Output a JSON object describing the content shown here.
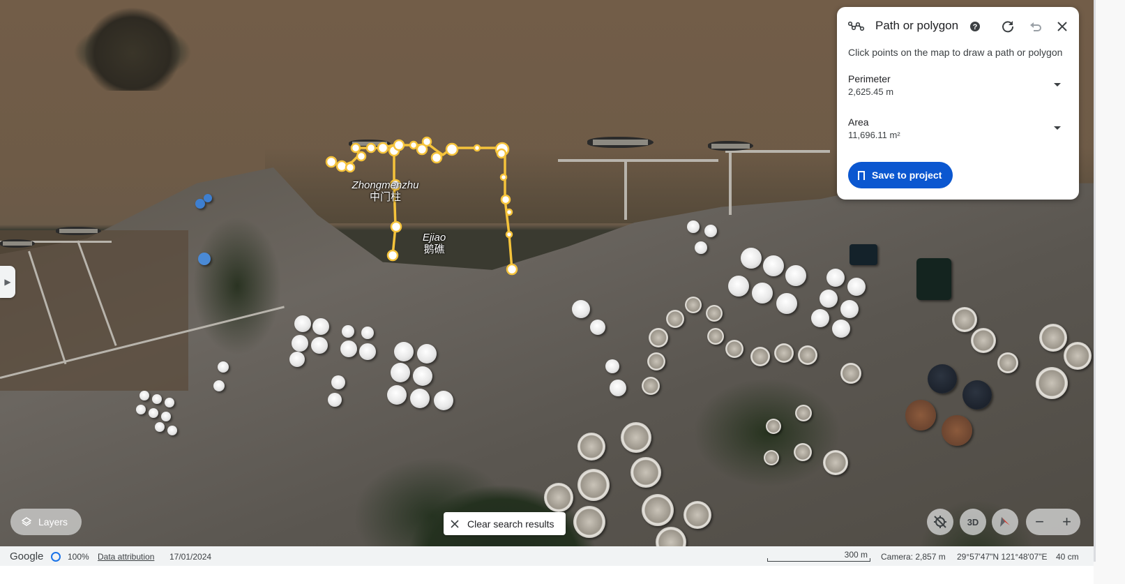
{
  "panel": {
    "title": "Path or polygon",
    "hint": "Click points on the map to draw a path or polygon",
    "perimeter": {
      "label": "Perimeter",
      "value": "2,625.45 m"
    },
    "area": {
      "label": "Area",
      "value": "11,696.11 m²"
    },
    "save_label": "Save to project",
    "icons": [
      "path-icon",
      "help-icon",
      "refresh-icon",
      "undo-icon",
      "close-icon"
    ]
  },
  "map": {
    "places": [
      {
        "name": "Zhongmenzhu",
        "zh": "中门柱"
      },
      {
        "name": "Ejiao",
        "zh": "鹅礁"
      }
    ]
  },
  "controls": {
    "layers_label": "Layers",
    "clear_label": "Clear search results",
    "three_d_label": "3D",
    "zoom_out": "−",
    "zoom_in": "+"
  },
  "status": {
    "brand": "Google",
    "quality": "100%",
    "attribution": "Data attribution",
    "date": "17/01/2024",
    "scale": "300 m",
    "camera": "Camera: 2,857 m",
    "coords": "29°57'47\"N 121°48'07\"E",
    "resolution": "40 cm"
  },
  "colors": {
    "accent": "#0b57d0",
    "polygon": "#f5c33b",
    "ring": "#1a73e8"
  }
}
